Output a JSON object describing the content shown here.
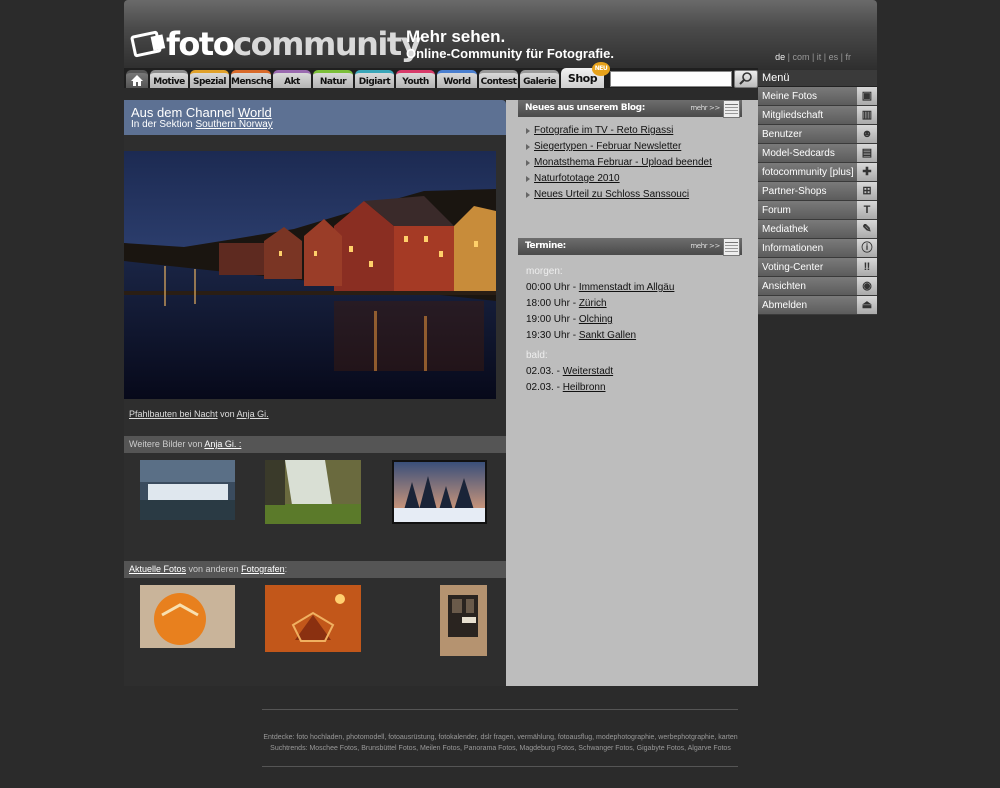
{
  "header": {
    "logo_text_a": "foto",
    "logo_text_b": "community",
    "slogan_line1": "Mehr sehen.",
    "slogan_line2": "Online-Community für Fotografie.",
    "languages": [
      "de",
      "com",
      "it",
      "es",
      "fr"
    ],
    "active_language": "de"
  },
  "tabs": [
    {
      "label": "Motive",
      "color": "#8c8c8c"
    },
    {
      "label": "Spezial",
      "color": "#e0a12a"
    },
    {
      "label": "Menschen",
      "color": "#d96a2a"
    },
    {
      "label": "Akt",
      "color": "#9a6ab0"
    },
    {
      "label": "Natur",
      "color": "#7cbf3a"
    },
    {
      "label": "Digiart",
      "color": "#3aa6b9"
    },
    {
      "label": "Youth",
      "color": "#d83b6a"
    },
    {
      "label": "World",
      "color": "#4a7fd0"
    },
    {
      "label": "Contest",
      "color": "#999999"
    },
    {
      "label": "Galerie",
      "color": "#999999"
    }
  ],
  "shop_tab": {
    "label": "Shop",
    "badge": "NEU"
  },
  "search": {
    "value": "",
    "placeholder": ""
  },
  "channel": {
    "prefix": "Aus dem Channel",
    "channel_name": "World",
    "section_prefix": "In der Sektion",
    "section_name": "Southern Norway"
  },
  "main_photo": {
    "title": "Pfahlbauten bei Nacht",
    "by": "von",
    "author": "Anja Gi."
  },
  "more_by": {
    "prefix": "Weitere Bilder von",
    "author": "Anja Gi. :"
  },
  "current": {
    "link1": "Aktuelle Fotos",
    "middle": "von anderen",
    "link2": "Fotografen",
    "suffix": ":"
  },
  "blog": {
    "title": "Neues aus unserem Blog:",
    "more": "mehr >>",
    "items": [
      "Fotografie im TV - Reto Rigassi",
      "Siegertypen - Februar Newsletter",
      "Monatsthema Februar - Upload beendet",
      "Naturfototage 2010",
      "Neues Urteil zu Schloss Sanssouci"
    ]
  },
  "termine": {
    "title": "Termine:",
    "more": "mehr >>",
    "tomorrow_label": "morgen:",
    "tomorrow": [
      {
        "time": "00:00 Uhr -",
        "place": "Immenstadt im Allgäu"
      },
      {
        "time": "18:00 Uhr -",
        "place": "Zürich"
      },
      {
        "time": "19:00 Uhr -",
        "place": "Olching"
      },
      {
        "time": "19:30 Uhr -",
        "place": "Sankt Gallen"
      }
    ],
    "soon_label": "bald:",
    "soon": [
      {
        "time": "02.03. -",
        "place": "Weiterstadt"
      },
      {
        "time": "02.03. -",
        "place": "Heilbronn"
      }
    ]
  },
  "menu": {
    "title": "Menü",
    "items": [
      {
        "label": "Meine Fotos",
        "icon": "camera-icon",
        "glyph": "▣"
      },
      {
        "label": "Mitgliedschaft",
        "icon": "membership-icon",
        "glyph": "▥"
      },
      {
        "label": "Benutzer",
        "icon": "users-icon",
        "glyph": "☻"
      },
      {
        "label": "Model-Sedcards",
        "icon": "sedcard-icon",
        "glyph": "▤"
      },
      {
        "label": "fotocommunity [plus]",
        "icon": "plus-icon",
        "glyph": "✚"
      },
      {
        "label": "Partner-Shops",
        "icon": "cart-icon",
        "glyph": "⊞"
      },
      {
        "label": "Forum",
        "icon": "forum-icon",
        "glyph": "T"
      },
      {
        "label": "Mediathek",
        "icon": "media-icon",
        "glyph": "✎"
      },
      {
        "label": "Informationen",
        "icon": "info-icon",
        "glyph": "ⓘ"
      },
      {
        "label": "Voting-Center",
        "icon": "voting-icon",
        "glyph": "‼"
      },
      {
        "label": "Ansichten",
        "icon": "eye-icon",
        "glyph": "◉"
      },
      {
        "label": "Abmelden",
        "icon": "logout-icon",
        "glyph": "⏏"
      }
    ]
  },
  "footer": {
    "line1": "Entdecke: foto hochladen, photomodell, fotoausrüstung, fotokalender, dslr fragen, vermählung, fotoausflug, modephotographie, werbephotgraphie, karten",
    "line2": "Suchtrends: Moschee Fotos, Brunsbüttel Fotos, Meilen Fotos, Panorama Fotos, Magdeburg Fotos, Schwanger Fotos, Gigabyte Fotos, Algarve Fotos"
  }
}
